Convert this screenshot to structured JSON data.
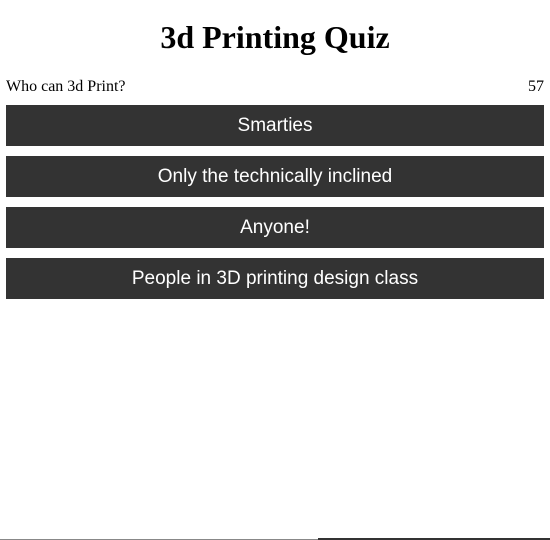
{
  "quiz": {
    "title": "3d Printing Quiz",
    "question": "Who can 3d Print?",
    "counter": "57",
    "answers": [
      {
        "label": "Smarties"
      },
      {
        "label": "Only the technically inclined"
      },
      {
        "label": "Anyone!"
      },
      {
        "label": "People in 3D printing design class"
      }
    ]
  },
  "colors": {
    "button_background": "#333333",
    "button_text": "#ffffff",
    "page_background": "#ffffff"
  }
}
